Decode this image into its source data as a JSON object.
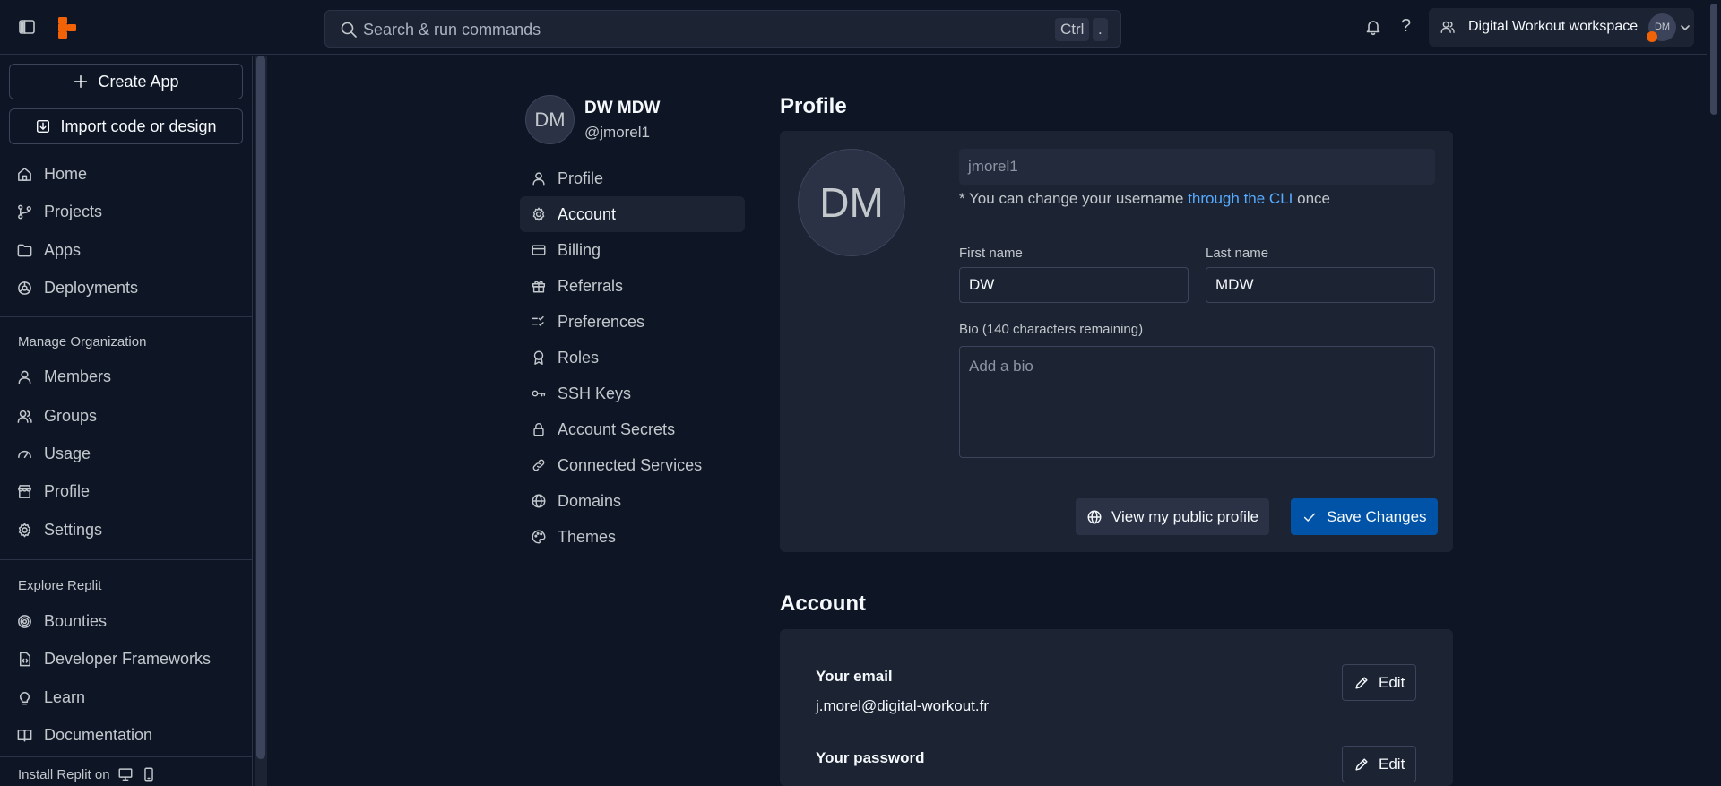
{
  "topbar": {
    "search_placeholder": "Search & run commands",
    "kbd_ctrl": "Ctrl",
    "kbd_dot": ".",
    "help_glyph": "?",
    "workspace_name": "Digital Workout workspace",
    "avatar_initials": "DM"
  },
  "sidebar": {
    "create_app": "Create App",
    "import": "Import code or design",
    "main_items": [
      {
        "label": "Home",
        "icon": "home-icon"
      },
      {
        "label": "Projects",
        "icon": "projects-icon"
      },
      {
        "label": "Apps",
        "icon": "folder-icon"
      },
      {
        "label": "Deployments",
        "icon": "deployments-icon"
      }
    ],
    "manage_title": "Manage Organization",
    "manage_items": [
      {
        "label": "Members",
        "icon": "user-icon"
      },
      {
        "label": "Groups",
        "icon": "users-icon"
      },
      {
        "label": "Usage",
        "icon": "gauge-icon"
      },
      {
        "label": "Profile",
        "icon": "storefront-icon"
      },
      {
        "label": "Settings",
        "icon": "gear-icon"
      }
    ],
    "explore_title": "Explore Replit",
    "explore_items": [
      {
        "label": "Bounties",
        "icon": "bounties-icon"
      },
      {
        "label": "Developer Frameworks",
        "icon": "code-file-icon"
      },
      {
        "label": "Learn",
        "icon": "lightbulb-icon"
      },
      {
        "label": "Documentation",
        "icon": "book-icon"
      }
    ],
    "install": "Install Replit on"
  },
  "user": {
    "initials": "DM",
    "display_name": "DW MDW",
    "handle": "@jmorel1"
  },
  "settings_nav": [
    {
      "label": "Profile",
      "icon": "user-icon"
    },
    {
      "label": "Account",
      "icon": "gear-icon",
      "active": true
    },
    {
      "label": "Billing",
      "icon": "credit-card-icon"
    },
    {
      "label": "Referrals",
      "icon": "gift-icon"
    },
    {
      "label": "Preferences",
      "icon": "checklist-icon"
    },
    {
      "label": "Roles",
      "icon": "badge-icon"
    },
    {
      "label": "SSH Keys",
      "icon": "key-icon"
    },
    {
      "label": "Account Secrets",
      "icon": "lock-icon"
    },
    {
      "label": "Connected Services",
      "icon": "link-icon"
    },
    {
      "label": "Domains",
      "icon": "globe-icon"
    },
    {
      "label": "Themes",
      "icon": "palette-icon"
    }
  ],
  "profile": {
    "title": "Profile",
    "avatar_initials": "DM",
    "username": "jmorel1",
    "hint_prefix": "* You can change your username ",
    "hint_link": "through the CLI",
    "hint_suffix": " once",
    "first_name_label": "First name",
    "first_name": "DW",
    "last_name_label": "Last name",
    "last_name": "MDW",
    "bio_label": "Bio (140 characters remaining)",
    "bio_placeholder": "Add a bio",
    "view_public": "View my public profile",
    "save": "Save Changes"
  },
  "account": {
    "title": "Account",
    "email_label": "Your email",
    "email": "j.morel@digital-workout.fr",
    "password_label": "Your password",
    "edit": "Edit"
  },
  "colors": {
    "background": "#0e1525",
    "surface": "#1c2333",
    "primary": "#0053a6",
    "link": "#57abff",
    "brand": "#f26207"
  }
}
